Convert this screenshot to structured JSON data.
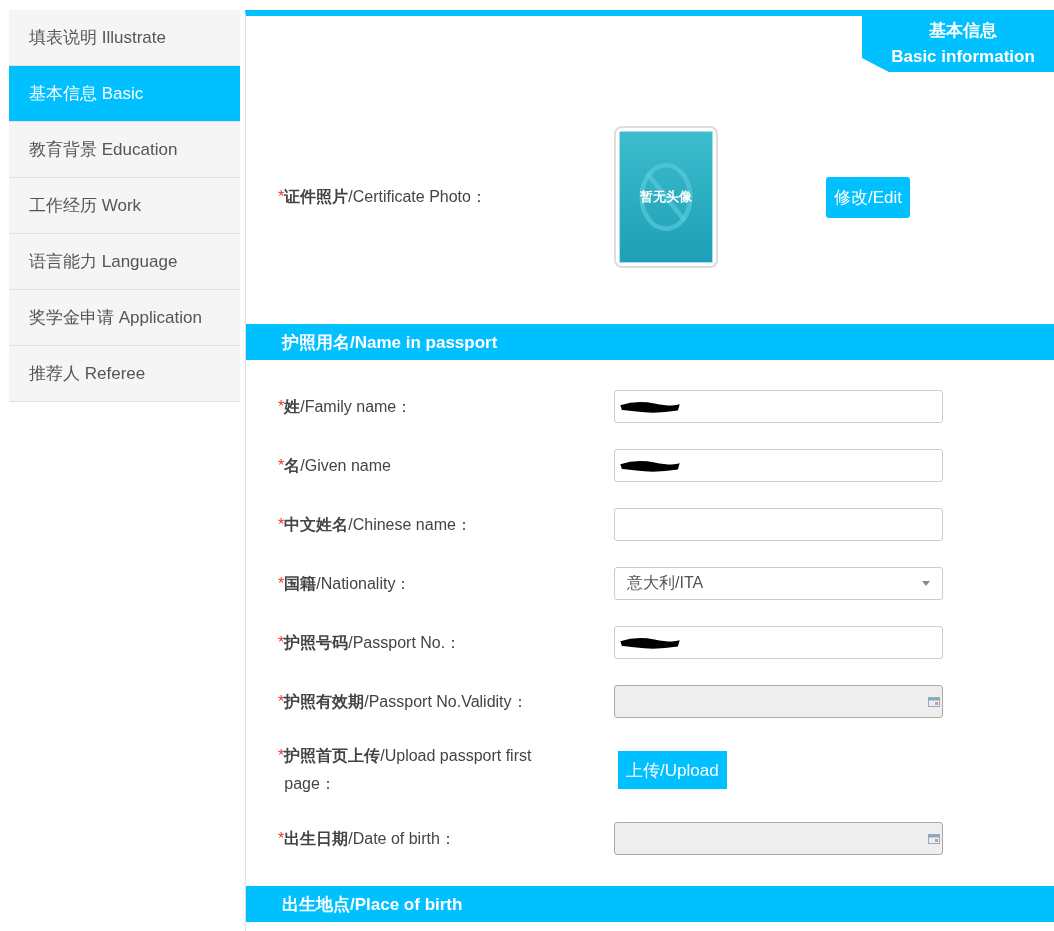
{
  "sidebar": {
    "items": [
      {
        "label": "填表说明 Illustrate",
        "selected": false
      },
      {
        "label": "基本信息 Basic",
        "selected": true
      },
      {
        "label": "教育背景 Education",
        "selected": false
      },
      {
        "label": "工作经历 Work",
        "selected": false
      },
      {
        "label": "语言能力 Language",
        "selected": false
      },
      {
        "label": "奖学金申请 Application",
        "selected": false
      },
      {
        "label": "推荐人 Referee",
        "selected": false
      }
    ]
  },
  "header_tab": {
    "title": "基本信息",
    "subtitle": "Basic information"
  },
  "required_mark": "*",
  "photo": {
    "label": "**证件照片**/Certificate Photo：",
    "required": true,
    "placeholder_text": "暂无头像",
    "button": "修改/Edit"
  },
  "sections": [
    {
      "title": "护照用名/Name in passport",
      "fields": [
        {
          "kind": "text",
          "label": "**姓**/Family name：",
          "required": true,
          "redacted": true
        },
        {
          "kind": "text",
          "label": "**名**/Given name",
          "required": true,
          "redacted": true
        },
        {
          "kind": "text",
          "label": "**中文姓名**/Chinese name：",
          "required": true
        },
        {
          "kind": "select",
          "label": "**国籍**/Nationality：",
          "required": true,
          "value": "意大利/ITA"
        },
        {
          "kind": "text",
          "label": "**护照号码**/Passport No.：",
          "required": true,
          "redacted": true
        },
        {
          "kind": "date",
          "label": "**护照有效期**/Passport No.Validity：",
          "required": true,
          "disabled": true
        },
        {
          "kind": "upload",
          "label": "**护照首页上传**/Upload passport first page：",
          "required": true,
          "button": "上传/Upload"
        },
        {
          "kind": "date",
          "label": "**出生日期**/Date of birth：",
          "required": true,
          "disabled": true
        }
      ]
    },
    {
      "title": "出生地点/Place of birth"
    }
  ]
}
